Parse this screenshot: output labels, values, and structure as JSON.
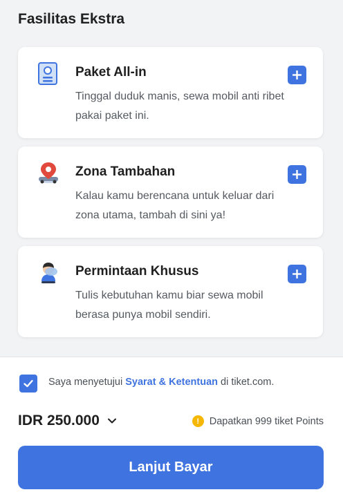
{
  "section": {
    "title": "Fasilitas Ekstra"
  },
  "cards": [
    {
      "icon": "id-card-icon",
      "title": "Paket All-in",
      "desc": "Tinggal duduk manis, sewa mobil anti ribet pakai paket ini."
    },
    {
      "icon": "map-pin-car-icon",
      "title": "Zona Tambahan",
      "desc": "Kalau kamu berencana untuk keluar dari zona utama, tambah di sini ya!"
    },
    {
      "icon": "special-request-icon",
      "title": "Permintaan Khusus",
      "desc": "Tulis kebutuhan kamu biar sewa mobil berasa punya mobil sendiri."
    }
  ],
  "agreement": {
    "checked": true,
    "prefix": "Saya menyetujui ",
    "link": "Syarat & Ketentuan",
    "suffix": " di tiket.com."
  },
  "price": {
    "value": "IDR 250.000"
  },
  "points": {
    "text": "Dapatkan 999 tiket Points"
  },
  "cta": {
    "label": "Lanjut Bayar"
  },
  "colors": {
    "accent": "#3f73e0",
    "coin": "#f5b700"
  }
}
